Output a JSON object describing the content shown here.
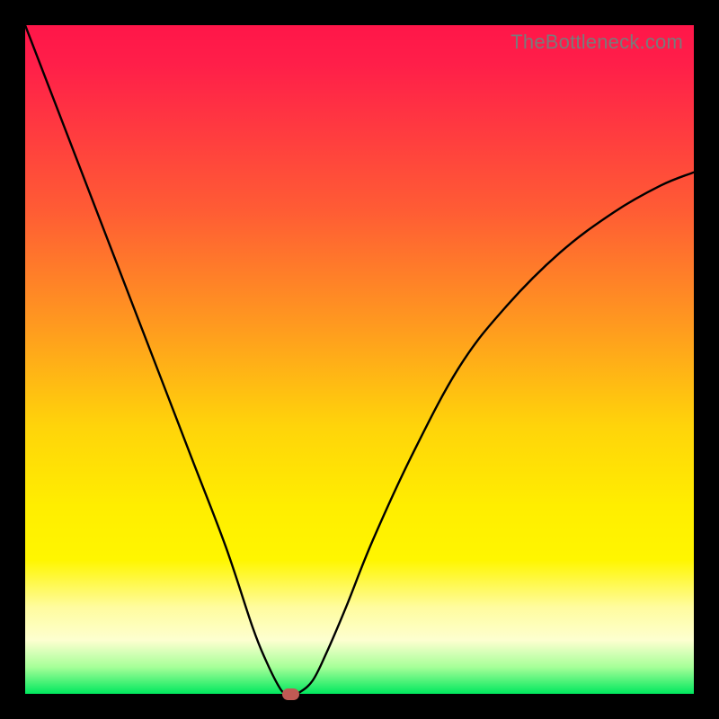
{
  "watermark": "TheBottleneck.com",
  "chart_data": {
    "type": "line",
    "title": "",
    "xlabel": "",
    "ylabel": "",
    "xlim": [
      0,
      100
    ],
    "ylim": [
      0,
      100
    ],
    "series": [
      {
        "name": "bottleneck-curve",
        "x": [
          0,
          5,
          10,
          15,
          20,
          25,
          30,
          34,
          36,
          38,
          39,
          40,
          41,
          43,
          45,
          48,
          52,
          58,
          65,
          72,
          80,
          88,
          95,
          100
        ],
        "y": [
          100,
          87,
          74,
          61,
          48,
          35,
          22,
          10,
          5,
          1,
          0,
          0,
          0.2,
          2,
          6,
          13,
          23,
          36,
          49,
          58,
          66,
          72,
          76,
          78
        ]
      }
    ],
    "marker": {
      "x": 39.7,
      "y": 0,
      "color": "#c05a54"
    },
    "background_gradient": [
      "#ff1649",
      "#ffee00",
      "#00e85e"
    ]
  }
}
